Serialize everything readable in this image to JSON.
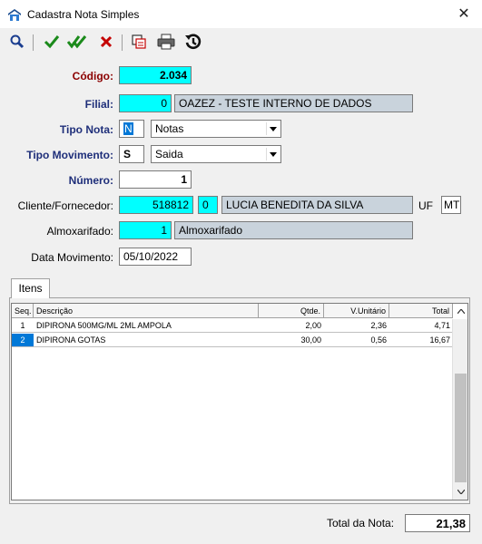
{
  "window": {
    "title": "Cadastra Nota Simples",
    "close": "✕"
  },
  "toolbar": {
    "icons": [
      "search-icon",
      "check-icon",
      "double-check-icon",
      "delete-icon",
      "copy-icon",
      "print-icon",
      "history-icon"
    ]
  },
  "colors": {
    "required_bg": "#00ffff",
    "readonly_bg": "#c9d3dc",
    "label_blue": "#1f2f7a",
    "label_red": "#8b0000",
    "selection": "#0078d7"
  },
  "form": {
    "codigo": {
      "label": "Código:",
      "value": "2.034"
    },
    "filial": {
      "label": "Filial:",
      "code": "0",
      "name": "OAZEZ - TESTE INTERNO DE DADOS"
    },
    "tipo_nota": {
      "label": "Tipo Nota:",
      "code": "N",
      "selected": "Notas"
    },
    "tipo_movimento": {
      "label": "Tipo Movimento:",
      "code": "S",
      "selected": "Saida"
    },
    "numero": {
      "label": "Número:",
      "value": "1"
    },
    "cliente": {
      "label": "Cliente/Fornecedor:",
      "code": "518812",
      "sub": "0",
      "name": "LUCIA BENEDITA DA SILVA",
      "uf_label": "UF",
      "uf": "MT"
    },
    "almoxarifado": {
      "label": "Almoxarifado:",
      "code": "1",
      "name": "Almoxarifado"
    },
    "data_movimento": {
      "label": "Data Movimento:",
      "value": "05/10/2022"
    }
  },
  "tabs": [
    {
      "label": "Itens"
    }
  ],
  "grid": {
    "columns": [
      "Seq.",
      "Descrição",
      "Qtde.",
      "V.Unitário",
      "Total"
    ],
    "rows": [
      {
        "seq": "1",
        "descricao": "DIPIRONA 500MG/ML 2ML AMPOLA",
        "qtde": "2,00",
        "unitario": "2,36",
        "total": "4,71"
      },
      {
        "seq": "2",
        "descricao": "DIPIRONA GOTAS",
        "qtde": "30,00",
        "unitario": "0,56",
        "total": "16,67"
      }
    ]
  },
  "footer": {
    "total_label": "Total da Nota:",
    "total_value": "21,38"
  }
}
